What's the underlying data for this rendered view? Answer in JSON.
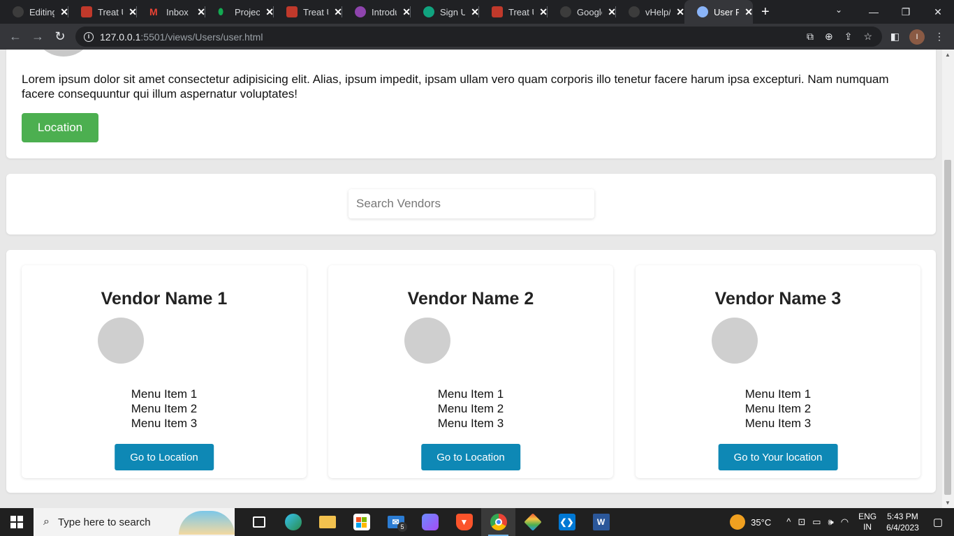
{
  "browser": {
    "tabs": [
      {
        "title": "Editing",
        "favicon_color": "#3c3c3c",
        "active": false
      },
      {
        "title": "Treat U",
        "favicon_color": "#c0392b",
        "active": false
      },
      {
        "title": "Inbox",
        "favicon_color": "#ea4335",
        "active": false
      },
      {
        "title": "Projec",
        "favicon_color": "#13aa52",
        "active": false
      },
      {
        "title": "Treat U",
        "favicon_color": "#c0392b",
        "active": false
      },
      {
        "title": "Introdu",
        "favicon_color": "#8e44ad",
        "active": false
      },
      {
        "title": "Sign U",
        "favicon_color": "#10a37f",
        "active": false
      },
      {
        "title": "Treat U",
        "favicon_color": "#c0392b",
        "active": false
      },
      {
        "title": "Google",
        "favicon_color": "#3c3c3c",
        "active": false
      },
      {
        "title": "vHelp/",
        "favicon_color": "#3c3c3c",
        "active": false
      },
      {
        "title": "User P",
        "favicon_color": "#8ab4f8",
        "active": true
      }
    ],
    "url_host": "127.0.0.1",
    "url_path": ":5501/views/Users/user.html",
    "profile_initial": "I"
  },
  "page": {
    "bio": "Lorem ipsum dolor sit amet consectetur adipisicing elit. Alias, ipsum impedit, ipsam ullam vero quam corporis illo tenetur facere harum ipsa excepturi. Nam numquam facere consequuntur qui illum aspernatur voluptates!",
    "location_button": "Location",
    "search_placeholder": "Search Vendors",
    "vendors": [
      {
        "name": "Vendor Name 1",
        "menu": [
          "Menu Item 1",
          "Menu Item 2",
          "Menu Item 3"
        ],
        "button": "Go to Location"
      },
      {
        "name": "Vendor Name 2",
        "menu": [
          "Menu Item 1",
          "Menu Item 2",
          "Menu Item 3"
        ],
        "button": "Go to Location"
      },
      {
        "name": "Vendor Name 3",
        "menu": [
          "Menu Item 1",
          "Menu Item 2",
          "Menu Item 3"
        ],
        "button": "Go to Your location"
      }
    ]
  },
  "taskbar": {
    "search_placeholder": "Type here to search",
    "mail_badge": "5",
    "temperature": "35°C",
    "lang_line1": "ENG",
    "lang_line2": "IN",
    "time": "5:43 PM",
    "date": "6/4/2023"
  }
}
